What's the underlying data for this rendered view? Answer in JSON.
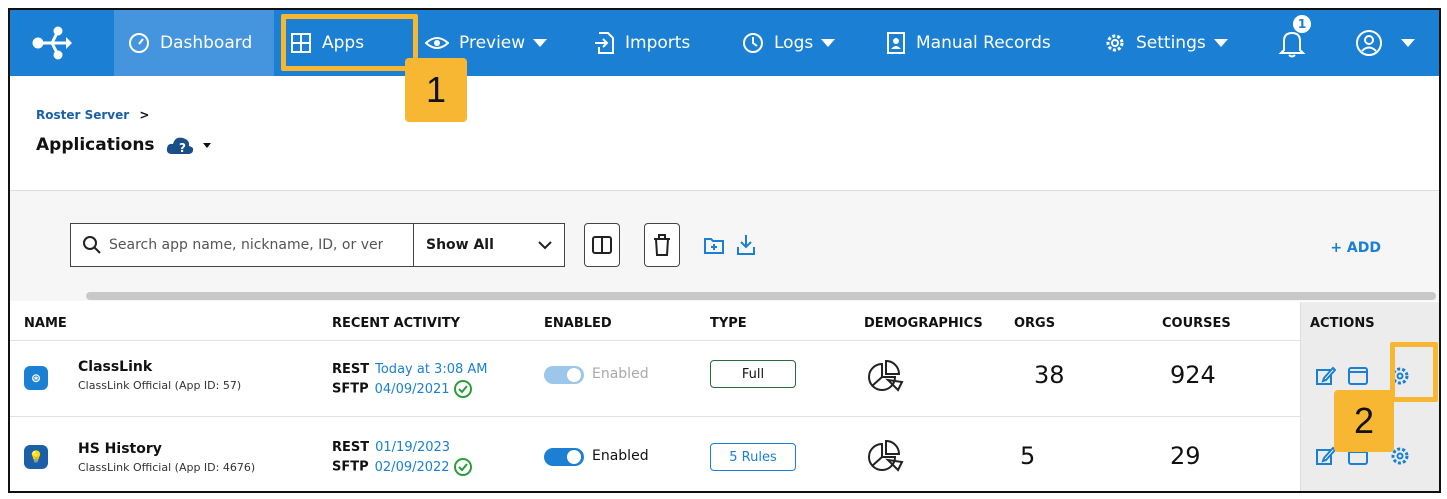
{
  "nav": {
    "logo": "share-network-icon",
    "items": [
      {
        "label": "Dashboard",
        "icon": "speedometer-icon"
      },
      {
        "label": "Apps",
        "icon": "grid-icon"
      },
      {
        "label": "Preview",
        "icon": "eye-icon"
      },
      {
        "label": "Imports",
        "icon": "import-file-icon"
      },
      {
        "label": "Logs",
        "icon": "clock-icon"
      },
      {
        "label": "Manual Records",
        "icon": "id-card-icon"
      },
      {
        "label": "Settings",
        "icon": "gear-icon"
      }
    ],
    "notification_count": "1",
    "colors": {
      "bar": "#1b80d4",
      "active": "#4595de",
      "highlight": "#f7b733"
    }
  },
  "callouts": [
    "1",
    "2"
  ],
  "breadcrumb": {
    "root": "Roster Server",
    "sep": ">"
  },
  "page": {
    "title": "Applications"
  },
  "toolbar": {
    "search_placeholder": "Search app name, nickname, ID, or ver",
    "filter_value": "Show All",
    "add_label": "+ ADD"
  },
  "table": {
    "headers": [
      "NAME",
      "RECENT ACTIVITY",
      "ENABLED",
      "TYPE",
      "DEMOGRAPHICS",
      "ORGS",
      "COURSES",
      "ACTIONS"
    ],
    "rows": [
      {
        "name": "ClassLink",
        "sub": "ClassLink Official (App ID: 57)",
        "rest_label": "REST",
        "rest_value": "Today at 3:08 AM",
        "sftp_label": "SFTP",
        "sftp_value": "04/09/2021",
        "enabled": "Enabled",
        "enabled_state": "disabled-on",
        "type": "Full",
        "orgs": "38",
        "courses": "924"
      },
      {
        "name": "HS History",
        "sub": "ClassLink Official (App ID: 4676)",
        "rest_label": "REST",
        "rest_value": "01/19/2023",
        "sftp_label": "SFTP",
        "sftp_value": "02/09/2022",
        "enabled": "Enabled",
        "enabled_state": "on",
        "type": "5 Rules",
        "orgs": "5",
        "courses": "29"
      }
    ]
  }
}
